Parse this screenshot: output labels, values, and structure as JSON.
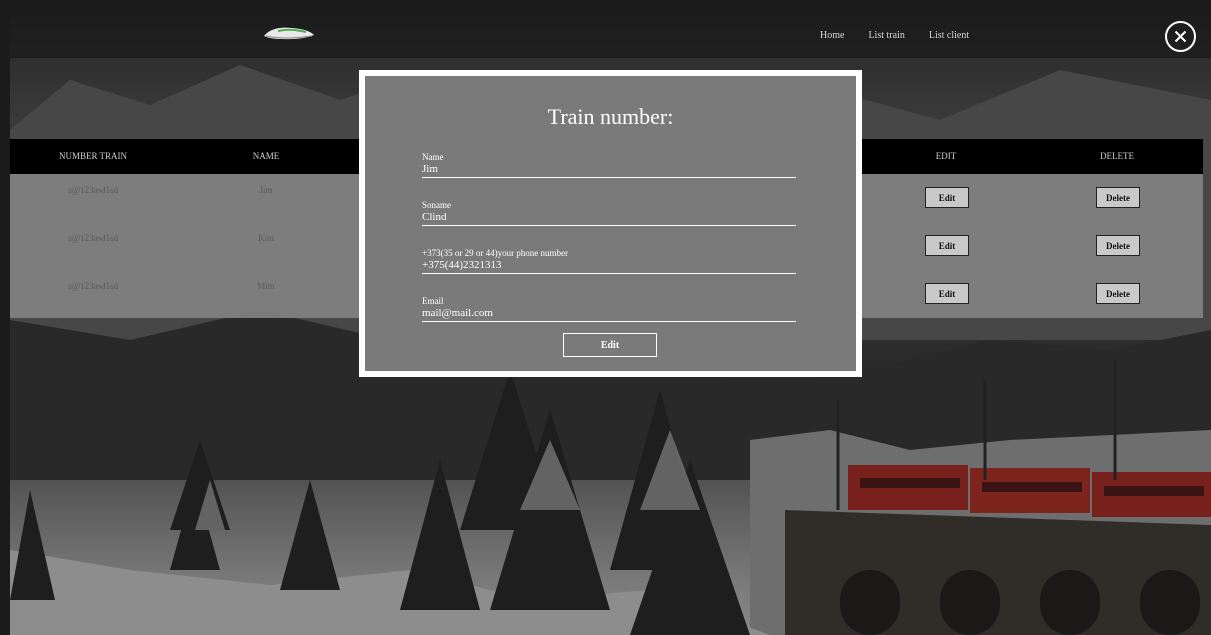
{
  "nav": {
    "links": [
      "Home",
      "List train",
      "List client"
    ]
  },
  "table": {
    "headers": [
      "NUMBER TRAIN",
      "NAME",
      "EDIT",
      "DELETE"
    ],
    "rows": [
      {
        "number": "a@123asd1sd",
        "name": "Jim",
        "edit": "Edit",
        "delete": "Delete"
      },
      {
        "number": "a@123asd1sd",
        "name": "Kim",
        "edit": "Edit",
        "delete": "Delete"
      },
      {
        "number": "a@123asd1sd",
        "name": "Mim",
        "edit": "Edit",
        "delete": "Delete"
      }
    ]
  },
  "modal": {
    "title": "Train number:",
    "fields": [
      {
        "label": "Name",
        "value": "Jim"
      },
      {
        "label": "Soname",
        "value": "Clind"
      },
      {
        "label": "+373(35 or 29 or 44)your phone number",
        "value": "+375(44)2321313"
      },
      {
        "label": "Email",
        "value": "mail@mail.com"
      }
    ],
    "submit_label": "Edit"
  },
  "icons": {
    "close": "close-icon",
    "logo": "train-logo-icon"
  },
  "colors": {
    "header_bg": "#000000",
    "modal_bg": "#7a7a7a",
    "table_bg": "#828282",
    "train": "#c0392b"
  }
}
